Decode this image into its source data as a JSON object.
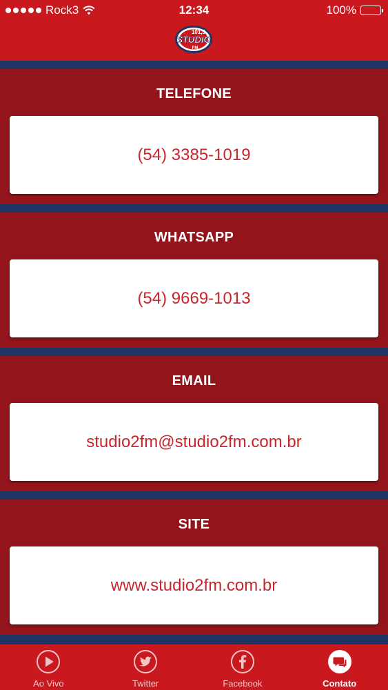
{
  "status_bar": {
    "carrier": "Rock3",
    "time": "12:34",
    "battery": "100%"
  },
  "header": {
    "logo_icon": "studio-fm-logo",
    "logo_text": "STUDIO 101.3 FM"
  },
  "sections": [
    {
      "title": "TELEFONE",
      "value": "(54) 3385-1019"
    },
    {
      "title": "WHATSAPP",
      "value": "(54) 9669-1013"
    },
    {
      "title": "EMAIL",
      "value": "studio2fm@studio2fm.com.br"
    },
    {
      "title": "SITE",
      "value": "www.studio2fm.com.br"
    }
  ],
  "tabs": [
    {
      "label": "Ao Vivo",
      "icon": "play-icon"
    },
    {
      "label": "Twitter",
      "icon": "twitter-icon"
    },
    {
      "label": "Facebook",
      "icon": "facebook-icon"
    },
    {
      "label": "Contato",
      "icon": "chat-icon",
      "active": true
    }
  ],
  "colors": {
    "header_red": "#c9191f",
    "section_red": "#93141b",
    "stripe_navy": "#1f3465",
    "value_red": "#c8262d"
  }
}
